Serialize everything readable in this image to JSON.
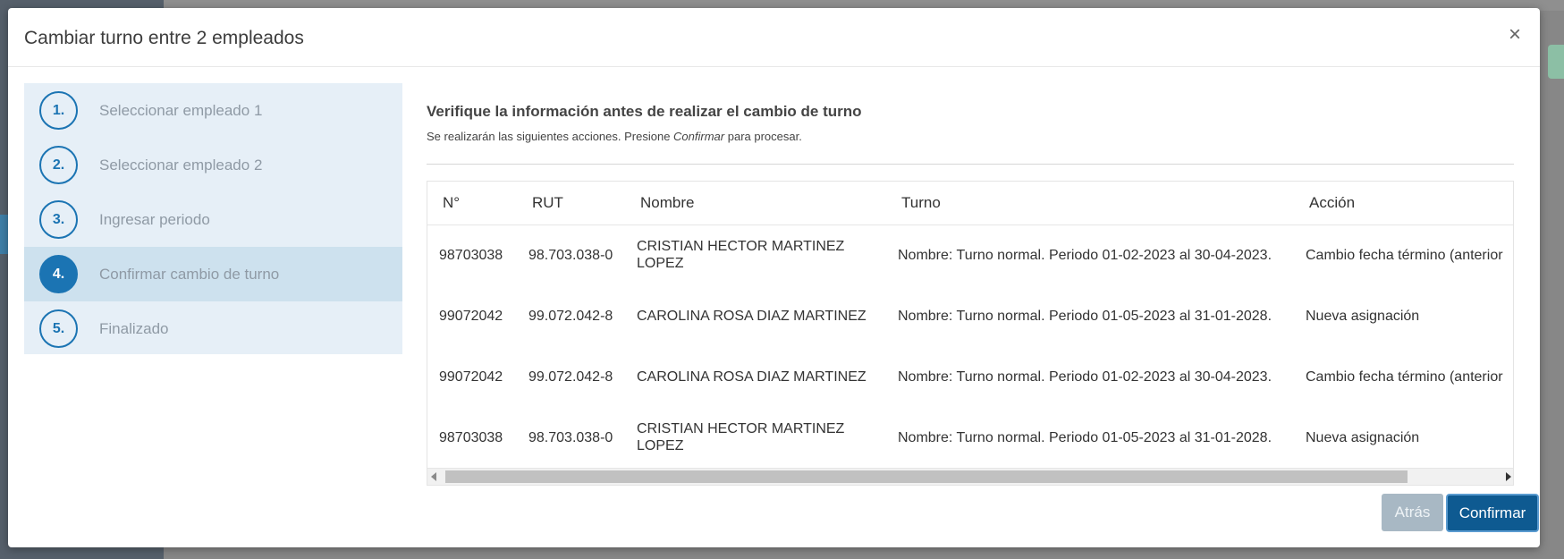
{
  "modal": {
    "title": "Cambiar turno entre 2 empleados",
    "close_symbol": "×"
  },
  "steps": [
    {
      "number": "1.",
      "label": "Seleccionar empleado 1",
      "active": false
    },
    {
      "number": "2.",
      "label": "Seleccionar empleado 2",
      "active": false
    },
    {
      "number": "3.",
      "label": "Ingresar periodo",
      "active": false
    },
    {
      "number": "4.",
      "label": "Confirmar cambio de turno",
      "active": true
    },
    {
      "number": "5.",
      "label": "Finalizado",
      "active": false
    }
  ],
  "content": {
    "title": "Verifique la información antes de realizar el cambio de turno",
    "subtitle_before": "Se realizarán las siguientes acciones. Presione ",
    "subtitle_emphasis": "Confirmar",
    "subtitle_after": " para procesar."
  },
  "table": {
    "headers": [
      "N°",
      "RUT",
      "Nombre",
      "Turno",
      "Acción"
    ],
    "rows": [
      [
        "98703038",
        "98.703.038-0",
        "CRISTIAN HECTOR MARTINEZ LOPEZ",
        "Nombre: Turno normal. Periodo 01-02-2023 al 30-04-2023.",
        "Cambio fecha término (anterior"
      ],
      [
        "99072042",
        "99.072.042-8",
        "CAROLINA ROSA DIAZ MARTINEZ",
        "Nombre: Turno normal. Periodo 01-05-2023 al 31-01-2028.",
        "Nueva asignación"
      ],
      [
        "99072042",
        "99.072.042-8",
        "CAROLINA ROSA DIAZ MARTINEZ",
        "Nombre: Turno normal. Periodo 01-02-2023 al 30-04-2023.",
        "Cambio fecha término (anterior"
      ],
      [
        "98703038",
        "98.703.038-0",
        "CRISTIAN HECTOR MARTINEZ LOPEZ",
        "Nombre: Turno normal. Periodo 01-05-2023 al 31-01-2028.",
        "Nueva asignación"
      ]
    ]
  },
  "footer": {
    "back_label": "Atrás",
    "confirm_label": "Confirmar"
  },
  "colors": {
    "primary": "#0e5a91",
    "step_accent": "#1b74b3",
    "steps_panel": "#e6eff7",
    "step_active_bg": "#cde1ee"
  }
}
